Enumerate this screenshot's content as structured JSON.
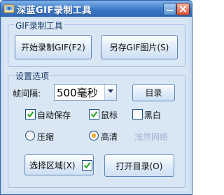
{
  "window": {
    "title": "深蓝GIF录制工具"
  },
  "gif_group": {
    "title": "GIF录制工具",
    "start_record_label": "开始录制GIF(F2)",
    "save_gif_label": "另存GIF图片(S)"
  },
  "settings": {
    "title": "设置选项",
    "interval_label": "帧间隔:",
    "interval_value": "500毫秒",
    "directory_button": "目录",
    "auto_save": {
      "label": "自动保存",
      "checked": true
    },
    "cursor": {
      "label": "鼠标",
      "checked": true
    },
    "grayscale": {
      "label": "黑白",
      "checked": false
    },
    "compress": {
      "label": "压缩",
      "selected": false
    },
    "high_quality": {
      "label": "高清",
      "selected": true
    },
    "watermark": "浅然网络",
    "select_area_label": "选择区域(X)",
    "select_area_checked": true,
    "open_directory_label": "打开目录(O)"
  },
  "colors": {
    "accent": "#2f66b2",
    "client_bg": "#d9e7f5",
    "radio_dot": "#f2a72c"
  }
}
